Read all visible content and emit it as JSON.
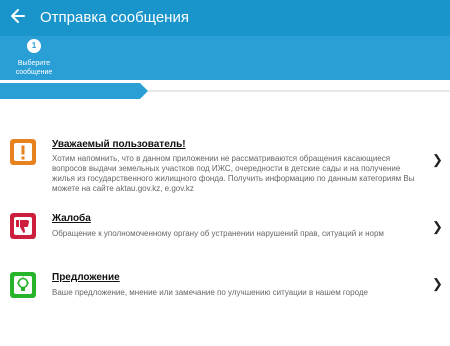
{
  "header": {
    "title": "Отправка сообщения",
    "back_icon": "arrow-left-icon",
    "color": "#1a95cc"
  },
  "stepper": {
    "step_number": "1",
    "step_label_line1": "Выберите",
    "step_label_line2": "сообщение",
    "color": "#2a9fd6"
  },
  "items": [
    {
      "title": "Уважаемый пользователь!",
      "description": "Хотим напомнить, что в данном приложении не рассматриваются обращения касающиеся вопросов выдачи земельных участков под ИЖС, очередности в детские сады и на получение жилья из государственного жилищного фонда. Получить информацию по данным категориям Вы можете на сайте aktau.gov.kz, e.gov.kz",
      "icon": "exclamation-icon",
      "icon_color": "#e8821e"
    },
    {
      "title": "Жалоба",
      "description": "Обращение к уполномоченному органу об устранении нарушений прав, ситуаций и норм",
      "icon": "thumbs-down-icon",
      "icon_color": "#cc1f3d"
    },
    {
      "title": "Предложение",
      "description": "Ваше предложение, мнение или замечание по улучшению ситуации в нашем городе",
      "icon": "lightbulb-icon",
      "icon_color": "#27b32a"
    }
  ],
  "chevron": "❯"
}
